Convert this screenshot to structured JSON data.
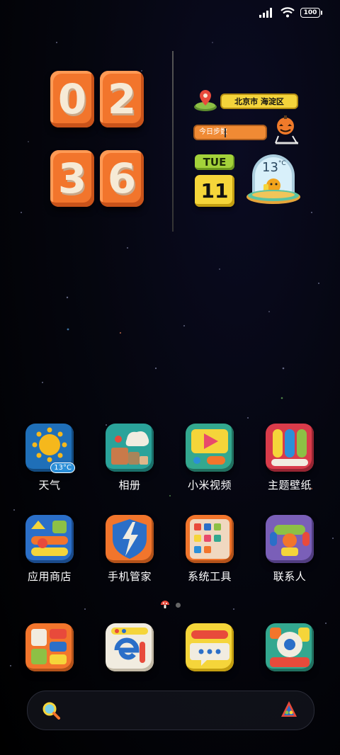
{
  "status_bar": {
    "battery": "100"
  },
  "clock": {
    "h1": "0",
    "h2": "2",
    "m1": "3",
    "m2": "6"
  },
  "widgets": {
    "location": "北京市 海淀区",
    "steps_label": "今日步数",
    "weekday": "TUE",
    "day": "11",
    "temperature": "13",
    "temperature_unit": "°C"
  },
  "apps_row1": [
    {
      "label": "天气",
      "icon": "weather-icon",
      "badge": "13°C"
    },
    {
      "label": "相册",
      "icon": "gallery-icon"
    },
    {
      "label": "小米视频",
      "icon": "video-icon"
    },
    {
      "label": "主题壁纸",
      "icon": "themes-icon"
    }
  ],
  "apps_row2": [
    {
      "label": "应用商店",
      "icon": "app-store-icon"
    },
    {
      "label": "手机管家",
      "icon": "security-icon"
    },
    {
      "label": "系统工具",
      "icon": "tools-icon"
    },
    {
      "label": "联系人",
      "icon": "contacts-icon"
    }
  ],
  "dock": [
    {
      "icon": "files-icon"
    },
    {
      "icon": "browser-icon"
    },
    {
      "icon": "messages-icon"
    },
    {
      "icon": "camera-icon"
    }
  ],
  "colors": {
    "orange": "#f2752c",
    "yellow": "#f4d43b",
    "green": "#a4d23a",
    "background": "#05060f"
  }
}
